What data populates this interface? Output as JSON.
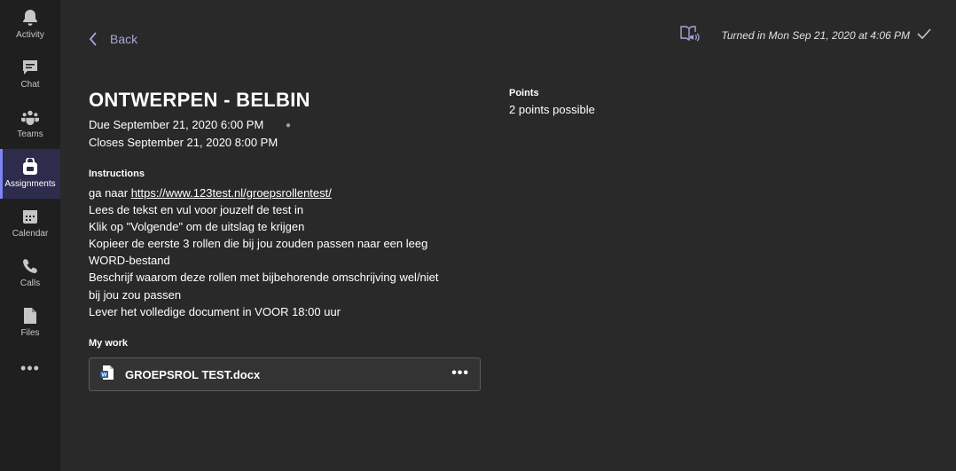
{
  "rail": {
    "items": [
      {
        "label": "Activity",
        "icon": "bell-icon"
      },
      {
        "label": "Chat",
        "icon": "chat-icon"
      },
      {
        "label": "Teams",
        "icon": "teams-icon"
      },
      {
        "label": "Assignments",
        "icon": "assignments-icon",
        "active": true
      },
      {
        "label": "Calendar",
        "icon": "calendar-icon"
      },
      {
        "label": "Calls",
        "icon": "phone-icon"
      },
      {
        "label": "Files",
        "icon": "file-icon"
      }
    ],
    "more": "•••"
  },
  "header": {
    "back_label": "Back",
    "status": "Turned in Mon Sep 21, 2020 at 4:06 PM"
  },
  "assignment": {
    "title": "ONTWERPEN - BELBIN",
    "due": "Due September 21, 2020 6:00 PM",
    "closes": "Closes September 21, 2020 8:00 PM",
    "instructions_heading": "Instructions",
    "instructions": {
      "line1_prefix": "ga naar ",
      "link": "https://www.123test.nl/groepsrollentest/",
      "line2": "Lees de tekst en vul voor jouzelf de test in",
      "line3": "Klik op \"Volgende\" om de uitslag te krijgen",
      "line4": "Kopieer de eerste 3 rollen die bij jou zouden passen naar een leeg",
      "line5": "WORD-bestand",
      "line6": "Beschrijf waarom deze rollen met bijbehorende omschrijving wel/niet",
      "line7": "bij jou zou passen",
      "line8": "Lever het volledige document in VOOR 18:00 uur"
    },
    "my_work_heading": "My work",
    "file_name": "GROEPSROL TEST.docx",
    "file_more": "•••"
  },
  "points": {
    "heading": "Points",
    "value": "2 points possible"
  },
  "colors": {
    "background": "#292929",
    "rail": "#1f1f1f",
    "accent": "#7f85f5",
    "link_purple": "#a6a7dc"
  }
}
